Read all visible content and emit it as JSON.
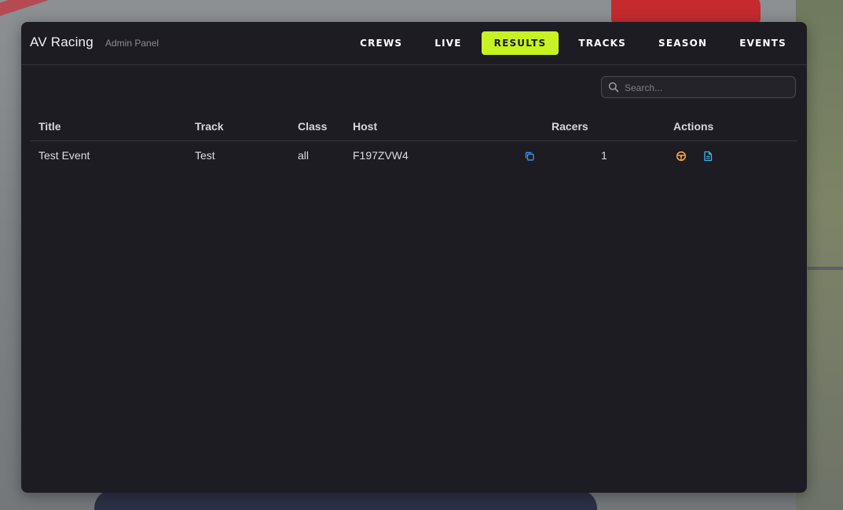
{
  "app": {
    "title": "AV Racing",
    "subtitle": "Admin Panel"
  },
  "nav": {
    "items": [
      {
        "label": "CREWS",
        "active": false
      },
      {
        "label": "LIVE",
        "active": false
      },
      {
        "label": "RESULTS",
        "active": true
      },
      {
        "label": "TRACKS",
        "active": false
      },
      {
        "label": "SEASON",
        "active": false
      },
      {
        "label": "EVENTS",
        "active": false
      }
    ],
    "active_color": "#c7f223"
  },
  "search": {
    "placeholder": "Search...",
    "value": ""
  },
  "table": {
    "columns": [
      "Title",
      "Track",
      "Class",
      "Host",
      "Racers",
      "Actions"
    ],
    "rows": [
      {
        "title": "Test Event",
        "track": "Test",
        "class": "all",
        "host": "F197ZVW4",
        "racers": "1",
        "icons": {
          "copy": "copy-icon",
          "wheel": "steering-wheel-icon",
          "doc": "document-icon"
        }
      }
    ]
  },
  "colors": {
    "panel": "#1d1c22",
    "copy_icon": "#3f8ee8",
    "wheel_icon": "#f0a23a",
    "doc_icon": "#35b6e8"
  }
}
